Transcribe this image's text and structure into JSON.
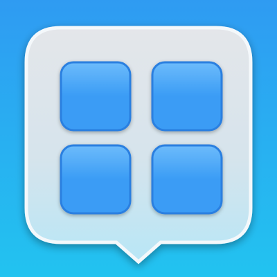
{
  "icon": {
    "name": "app-grid-speech-bubble-icon",
    "colors": {
      "background_top": "#2f9bf2",
      "background_bottom": "#22c3f0",
      "bubble_top": "#e4e6ea",
      "bubble_bottom": "#b8e6f6",
      "tile_fill": "#3a9cf5",
      "tile_highlight": "#6dbbfb",
      "tile_border": "#2a7fe0"
    },
    "grid": {
      "rows": 2,
      "columns": 2
    }
  }
}
